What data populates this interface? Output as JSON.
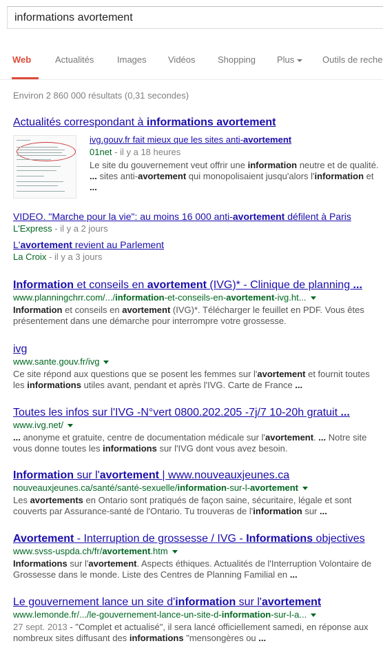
{
  "search": {
    "query": "informations avortement"
  },
  "tabs": [
    "Web",
    "Actualités",
    "Images",
    "Vidéos",
    "Shopping",
    "Plus",
    "Outils de reche"
  ],
  "stats": "Environ 2 860 000 résultats (0,31 secondes)",
  "news": {
    "header_a": "Actualités correspondant à ",
    "header_b": "informations avortement",
    "main": {
      "title_a": "ivg.gouv.fr fait mieux que les sites anti-",
      "title_b": "avortement",
      "source": "01net",
      "time": " - il y a 18 heures",
      "snippet": [
        [
          "Le site du gouvernement veut offrir une ",
          false
        ],
        [
          "information",
          true
        ],
        [
          " neutre et de qualité. ",
          false
        ],
        [
          "...",
          true
        ],
        [
          " sites anti-",
          false
        ],
        [
          "avortement",
          true
        ],
        [
          " qui monopolisaient jusqu'alors l'",
          false
        ],
        [
          "information",
          true
        ],
        [
          " et ",
          false
        ],
        [
          "...",
          true
        ]
      ]
    },
    "sub": [
      {
        "title": [
          [
            "VIDEO. \"Marche pour la vie\": au moins 16 000 anti-",
            false
          ],
          [
            "avortement",
            true
          ],
          [
            " défilent à Paris",
            false
          ]
        ],
        "source": "L'Express",
        "time": " - il y a 2 jours"
      },
      {
        "title": [
          [
            "L'",
            false
          ],
          [
            "avortement",
            true
          ],
          [
            " revient au Parlement",
            false
          ]
        ],
        "source": "La Croix",
        "time": " - il y a 3 jours"
      }
    ]
  },
  "results": [
    {
      "title": [
        [
          "Information",
          true
        ],
        [
          " et conseils en ",
          false
        ],
        [
          "avortement",
          true
        ],
        [
          " (IVG)* - Clinique de planning ",
          false
        ],
        [
          "...",
          true
        ]
      ],
      "url": [
        [
          "www.planningchrr.com/.../",
          false
        ],
        [
          "information",
          true
        ],
        [
          "-et-conseils-en-",
          false
        ],
        [
          "avortement",
          true
        ],
        [
          "-ivg.ht...",
          false
        ]
      ],
      "snippet": [
        [
          "Information",
          true
        ],
        [
          " et conseils en ",
          false
        ],
        [
          "avortement",
          true
        ],
        [
          " (IVG)*. Télécharger le feuillet en PDF. Vous êtes présentement dans une démarche pour interrompre votre grossesse.",
          false
        ]
      ]
    },
    {
      "title": [
        [
          "ivg",
          false
        ]
      ],
      "url": [
        [
          "www.sante.gouv.fr/ivg",
          false
        ]
      ],
      "snippet": [
        [
          "Ce site répond aux questions que se posent les femmes sur l'",
          false
        ],
        [
          "avortement",
          true
        ],
        [
          " et fournit toutes les ",
          false
        ],
        [
          "informations",
          true
        ],
        [
          " utiles avant, pendant et après l'IVG. Carte de France ",
          false
        ],
        [
          "...",
          true
        ]
      ]
    },
    {
      "title": [
        [
          "Toutes les infos sur l'IVG -N°vert 0800.202.205 -7j/7 10-20h gratuit ",
          false
        ],
        [
          "...",
          true
        ]
      ],
      "url": [
        [
          "www.ivg.net/",
          false
        ]
      ],
      "snippet": [
        [
          "...",
          true
        ],
        [
          " anonyme et gratuite, centre de documentation médicale sur l'",
          false
        ],
        [
          "avortement",
          true
        ],
        [
          ". ",
          false
        ],
        [
          "...",
          true
        ],
        [
          " Notre site vous donne toutes les ",
          false
        ],
        [
          "informations",
          true
        ],
        [
          " sur l'IVG dont vous avez besoin.",
          false
        ]
      ]
    },
    {
      "title": [
        [
          "Information",
          true
        ],
        [
          " sur l'",
          false
        ],
        [
          "avortement",
          true
        ],
        [
          " | www.nouveauxjeunes.ca",
          false
        ]
      ],
      "url": [
        [
          "nouveauxjeunes.ca/santé/santé-sexuelle/",
          false
        ],
        [
          "information",
          true
        ],
        [
          "-sur-l-",
          false
        ],
        [
          "avortement",
          true
        ]
      ],
      "snippet": [
        [
          "Les ",
          false
        ],
        [
          "avortements",
          true
        ],
        [
          " en Ontario sont pratiqués de façon saine, sécuritaire, légale et sont couverts par Assurance-santé de l'Ontario. Tu trouveras de l'",
          false
        ],
        [
          "information",
          true
        ],
        [
          " sur ",
          false
        ],
        [
          "...",
          true
        ]
      ]
    },
    {
      "title": [
        [
          "Avortement",
          true
        ],
        [
          " - Interruption de grossesse / IVG - ",
          false
        ],
        [
          "Informations",
          true
        ],
        [
          " objectives",
          false
        ]
      ],
      "url": [
        [
          "www.svss-uspda.ch/fr/",
          false
        ],
        [
          "avortement",
          true
        ],
        [
          ".htm",
          false
        ]
      ],
      "snippet": [
        [
          "Informations",
          true
        ],
        [
          " sur l'",
          false
        ],
        [
          "avortement",
          true
        ],
        [
          ". Aspects éthiques. Actualités de l'Interruption Volontaire de Grossesse dans le monde. Liste des Centres de Planning Familial en ",
          false
        ],
        [
          "...",
          true
        ]
      ]
    },
    {
      "title": [
        [
          "Le gouvernement lance un site d'",
          false
        ],
        [
          "information",
          true
        ],
        [
          " sur l'",
          false
        ],
        [
          "avortement",
          true
        ]
      ],
      "url": [
        [
          "www.lemonde.fr/.../le-gouvernement-lance-un-site-d-",
          false
        ],
        [
          "information",
          true
        ],
        [
          "-sur-l-a...",
          false
        ]
      ],
      "date": "27 sept. 2013",
      "snippet": [
        [
          " - \"Complet et actualisé\", il sera lancé officiellement samedi, en réponse aux nombreux sites diffusant des ",
          false
        ],
        [
          "informations",
          true
        ],
        [
          " \"mensongères ou ",
          false
        ],
        [
          "...",
          true
        ]
      ]
    }
  ]
}
